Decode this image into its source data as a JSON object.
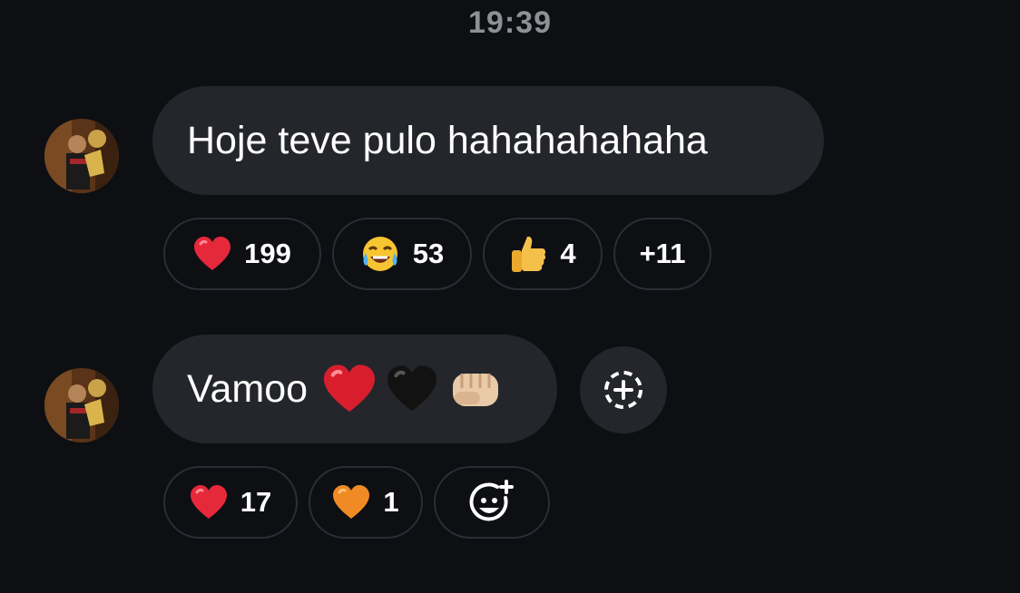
{
  "timestamp": "19:39",
  "messages": [
    {
      "avatar_icon": "profile-photo",
      "text": "Hoje teve pulo hahahahahaha",
      "reactions": [
        {
          "emoji": "red-heart",
          "count": "199"
        },
        {
          "emoji": "tears-of-joy",
          "count": "53"
        },
        {
          "emoji": "thumbs-up",
          "count": "4"
        },
        {
          "more": "+11"
        }
      ]
    },
    {
      "avatar_icon": "profile-photo",
      "text": "Vamoo",
      "text_emojis": [
        "red-heart",
        "black-heart",
        "oncoming-fist"
      ],
      "side_action_icon": "add-circle-dashed-icon",
      "reactions": [
        {
          "emoji": "red-heart",
          "count": "17"
        },
        {
          "emoji": "orange-heart",
          "count": "1"
        },
        {
          "add_icon": "add-reaction-icon"
        }
      ]
    }
  ],
  "colors": {
    "background": "#0d0f13",
    "bubble": "#24262c",
    "pill_border": "#2b2e35",
    "timestamp": "#8e9096"
  }
}
